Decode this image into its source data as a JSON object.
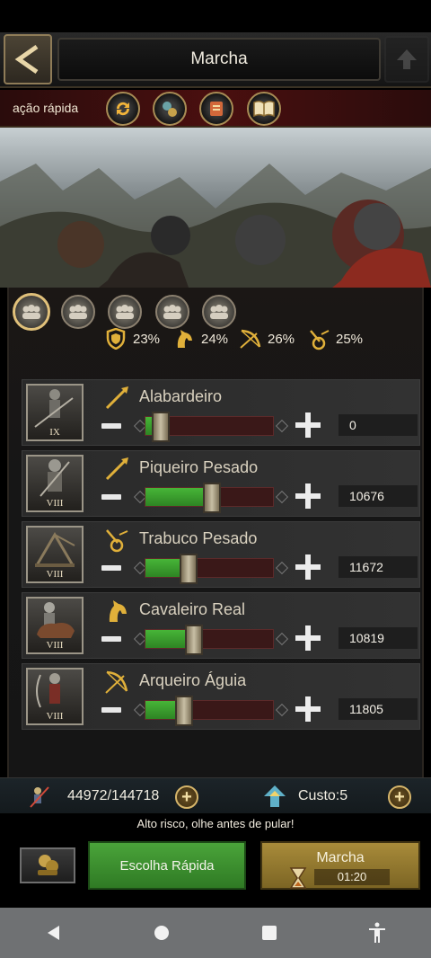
{
  "header": {
    "title": "Marcha"
  },
  "quick": {
    "label": "ação rápida",
    "icons": [
      "refresh-icon",
      "troops-coins-icon",
      "scroll-icon",
      "book-icon"
    ]
  },
  "presets": [
    "preset-1",
    "preset-2",
    "preset-3",
    "preset-4",
    "preset-5"
  ],
  "bonuses": [
    {
      "icon": "shield-icon",
      "value": "23%"
    },
    {
      "icon": "horse-icon",
      "value": "24%"
    },
    {
      "icon": "bow-icon",
      "value": "26%"
    },
    {
      "icon": "siege-icon",
      "value": "25%"
    }
  ],
  "troops": [
    {
      "name": "Alabardeiro",
      "tier": "IX",
      "type_icon": "spear-icon",
      "count": "0",
      "fill": 0.12
    },
    {
      "name": "Piqueiro Pesado",
      "tier": "VIII",
      "type_icon": "spear-icon",
      "count": "10676",
      "fill": 0.52
    },
    {
      "name": "Trabuco Pesado",
      "tier": "VIII",
      "type_icon": "siege-icon",
      "count": "11672",
      "fill": 0.34
    },
    {
      "name": "Cavaleiro Real",
      "tier": "VIII",
      "type_icon": "horse-icon",
      "count": "10819",
      "fill": 0.38
    },
    {
      "name": "Arqueiro Águia",
      "tier": "VIII",
      "type_icon": "bow-icon",
      "count": "11805",
      "fill": 0.3
    }
  ],
  "footer": {
    "capacity": "44972/144718",
    "cost": "Custo:5",
    "warning": "Alto risco, olhe antes de pular!",
    "quick_button": "Escolha Rápida",
    "march_button": "Marcha",
    "march_time": "01:20"
  },
  "colors": {
    "accent_gold": "#d6b56a",
    "slider_fill": "#47b538",
    "quick_button": "#4aa43a",
    "march_button": "#a88b3a"
  }
}
